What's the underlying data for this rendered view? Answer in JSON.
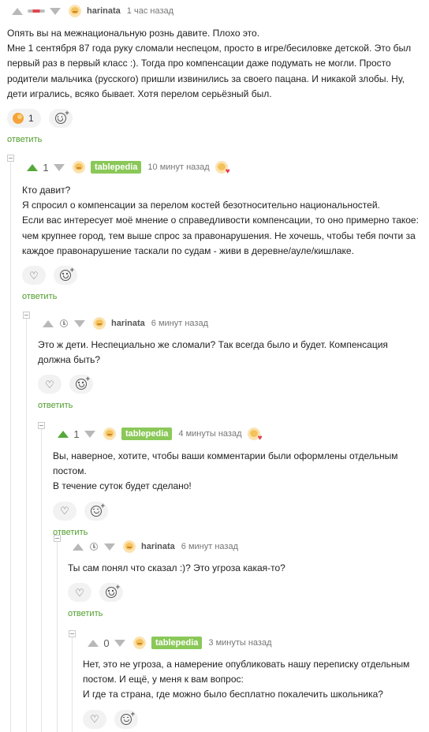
{
  "comments": [
    {
      "nick": "harinata",
      "time": "1 час назад",
      "text": "Опять вы на межнациональную рознь давите. Плохо это.\nМне 1 сентября 87 года руку сломали неспецом, просто в игре/бесиловке детской. Это был первый раз в первый класс :). Тогда про компенсации даже подумать не могли. Просто родители мальчика (русского) пришли извинились за своего пацана. И никакой злобы. Ну, дети игрались, всяко бывает. Хотя перелом серьёзный был.",
      "reaction_icon": "reaction-emoji-icon",
      "reaction_count": "1",
      "reply": "ответить"
    },
    {
      "rating": "1",
      "nick": "tablepedia",
      "time": "10 минут назад",
      "text": "Кто давит?\nЯ спросил о компенсации за перелом костей безотносительно национальностей.\nЕсли вас интересует моё мнение о справедливости компенсации, то оно примерно такое: чем крупнее город, тем выше спрос за правонарушения. Не хочешь, чтобы тебя почти за каждое правонарушение таскали по судам - живи в деревне/ауле/кишлаке.",
      "reply": "ответить"
    },
    {
      "nick": "harinata",
      "time": "6 минут назад",
      "text": "Это ж дети. Неспециально же сломали? Так всегда было и будет. Компенсация должна быть?",
      "reply": "ответить"
    },
    {
      "rating": "1",
      "nick": "tablepedia",
      "time": "4 минуты назад",
      "text": "Вы, наверное, хотите, чтобы ваши комментарии были оформлены отдельным постом.\nВ течение суток будет сделано!",
      "reply": "ответить"
    },
    {
      "nick": "harinata",
      "time": "6 минут назад",
      "text": "Ты сам понял что сказал :)? Это угроза какая-то?",
      "reply": "ответить"
    },
    {
      "rating": "0",
      "nick": "tablepedia",
      "time": "3 минуты назад",
      "text": "Нет, это не угроза, а намерение опубликовать нашу переписку отдельным постом. И ещё, у меня к вам вопрос:\nИ где та страна, где можно было бесплатно покалечить школьника?"
    }
  ],
  "colors": {
    "accent_green": "#4f9d2d",
    "tag_green": "#8ac858",
    "upvote_green": "#55a83a",
    "heart_red": "#e43d4f"
  }
}
